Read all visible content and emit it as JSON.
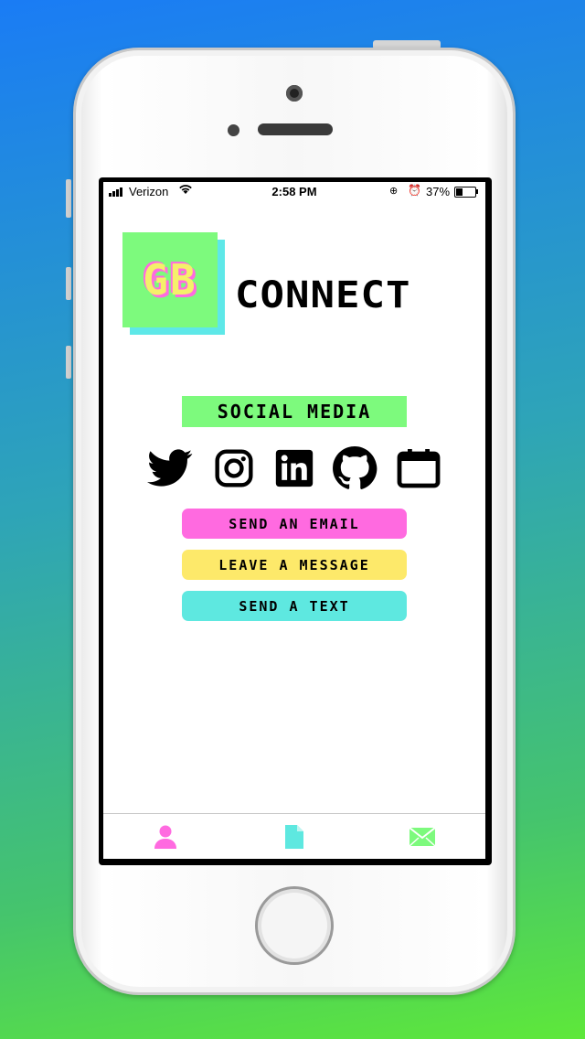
{
  "status_bar": {
    "carrier": "Verizon",
    "time": "2:58 PM",
    "battery": "37%",
    "battery_level": 0.37,
    "icons": [
      "signal-icon",
      "wifi-icon",
      "orientation-lock-icon",
      "alarm-icon",
      "battery-icon"
    ]
  },
  "logo": {
    "initials": "GB",
    "wordmark": "CONNECT"
  },
  "section": {
    "label": "SOCIAL MEDIA"
  },
  "social_icons": [
    "twitter-icon",
    "instagram-icon",
    "linkedin-icon",
    "github-icon",
    "calendar-icon"
  ],
  "buttons": {
    "email": "SEND AN EMAIL",
    "message": "LEAVE A MESSAGE",
    "text": "SEND A TEXT"
  },
  "tabs": [
    "profile-icon",
    "document-icon",
    "mail-icon"
  ],
  "colors": {
    "green": "#7dfa7d",
    "pink": "#ff6ae0",
    "yellow": "#fde96a",
    "cyan": "#5ee8e0"
  }
}
